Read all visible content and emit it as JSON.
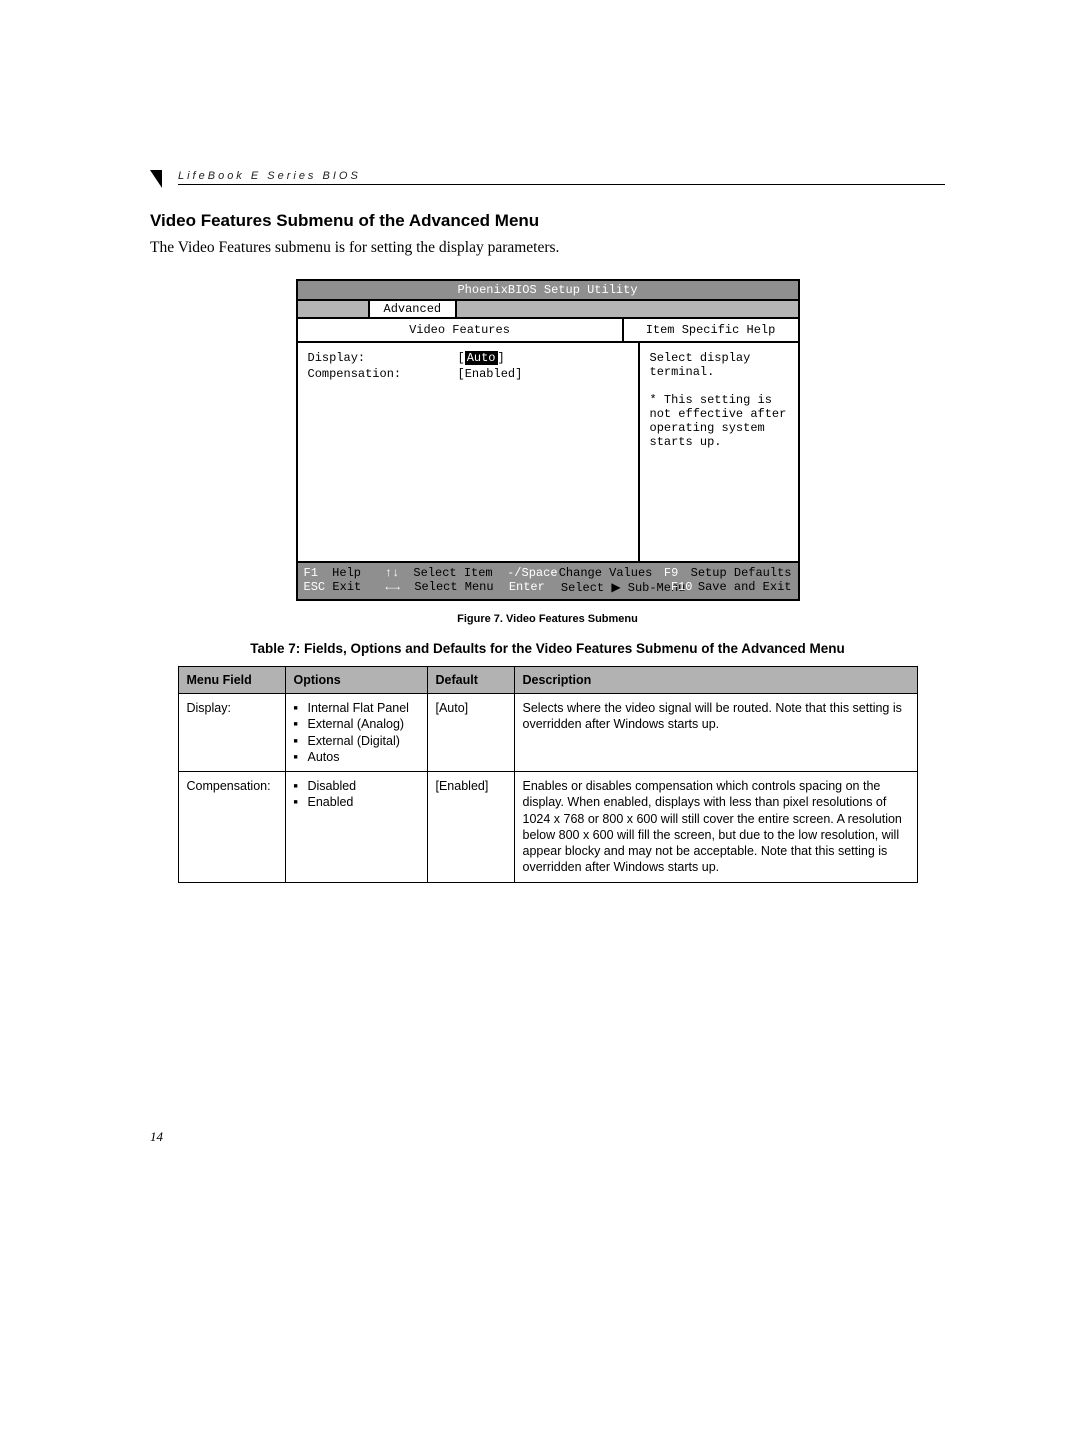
{
  "header": {
    "running": "LifeBook E Series BIOS"
  },
  "section": {
    "title": "Video Features Submenu of the Advanced Menu",
    "intro": "The Video Features submenu is for setting the display parameters."
  },
  "bios": {
    "utility_title": "PhoenixBIOS Setup Utility",
    "active_tab": "Advanced",
    "main_title": "Video Features",
    "help_title": "Item Specific Help",
    "fields": [
      {
        "label": "Display:",
        "value": "Auto",
        "highlighted": true
      },
      {
        "label": "Compensation:",
        "value": "[Enabled]",
        "highlighted": false
      }
    ],
    "help_text": "Select display terminal.\n\n* This setting is not effective after operating system starts up.",
    "footer": {
      "r1": {
        "k1": "F1",
        "t1": "Help",
        "k2": "↑↓",
        "t2": "Select Item",
        "k3": "-/Space",
        "t3": "Change Values",
        "k4": "F9",
        "t4": "Setup Defaults"
      },
      "r2": {
        "k1": "ESC",
        "t1": "Exit",
        "k2": "←→",
        "t2": "Select Menu",
        "k3": "Enter",
        "t3_a": "Select",
        "t3_b": "Sub-Menu",
        "k4": "F10",
        "t4": "Save and Exit"
      }
    }
  },
  "figure_caption": "Figure 7.  Video Features Submenu",
  "table_caption": "Table 7: Fields, Options and Defaults for the Video Features Submenu of the Advanced Menu",
  "table": {
    "headers": [
      "Menu Field",
      "Options",
      "Default",
      "Description"
    ],
    "rows": [
      {
        "field": "Display:",
        "options": [
          "Internal Flat Panel",
          "External (Analog)",
          "External (Digital)",
          "Autos"
        ],
        "default": "[Auto]",
        "description": "Selects where the video signal will be routed. Note that this setting is overridden after Windows starts up."
      },
      {
        "field": "Compensation:",
        "options": [
          "Disabled",
          "Enabled"
        ],
        "default": "[Enabled]",
        "description": "Enables or disables compensation which controls spacing on the display. When enabled, displays with less than pixel resolutions of 1024 x 768 or 800 x 600 will still cover the entire screen. A resolution below 800 x 600 will fill the screen, but due to the low resolution, will appear blocky and may not be acceptable. Note that this setting is overridden after Windows starts up."
      }
    ]
  },
  "page_number": "14"
}
